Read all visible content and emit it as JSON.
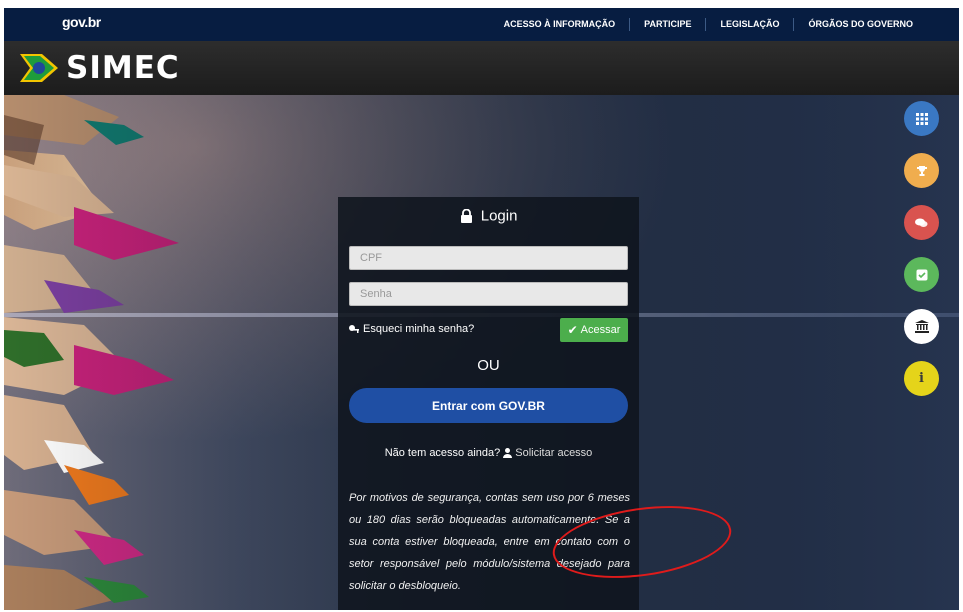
{
  "govbar": {
    "logo": "gov.br",
    "links": [
      "ACESSO À INFORMAÇÃO",
      "PARTICIPE",
      "LEGISLAÇÃO",
      "ÓRGÃOS DO GOVERNO"
    ]
  },
  "header": {
    "brand": "SIMEC"
  },
  "login": {
    "title": "Login",
    "cpf_placeholder": "CPF",
    "senha_placeholder": "Senha",
    "forgot": "Esqueci minha senha?",
    "submit": "Acessar",
    "or": "OU",
    "govbr_button": "Entrar com  GOV.BR",
    "no_access_text": "Não tem acesso ainda?",
    "request_access": "Solicitar acesso",
    "notice": "Por motivos de segurança, contas sem uso por 6 meses ou 180 dias serão bloqueadas automaticamente. Se a sua conta estiver bloqueada, entre em contato com o setor responsável pelo módulo/sistema desejado para solicitar o desbloqueio."
  },
  "side_buttons": [
    {
      "icon": "grid-icon",
      "color": "#3a78c3"
    },
    {
      "icon": "trophy-icon",
      "color": "#f0ad4e"
    },
    {
      "icon": "comments-icon",
      "color": "#d9534f"
    },
    {
      "icon": "check-square-icon",
      "color": "#5cb85c"
    },
    {
      "icon": "institution-icon",
      "color": "#ffffff"
    },
    {
      "icon": "info-icon",
      "color": "#e5d41a"
    }
  ],
  "colors": {
    "govbar": "#071d41",
    "govbr_button": "#1f4fa4",
    "acessar": "#4cae4c",
    "annotation": "#e01b1b"
  }
}
